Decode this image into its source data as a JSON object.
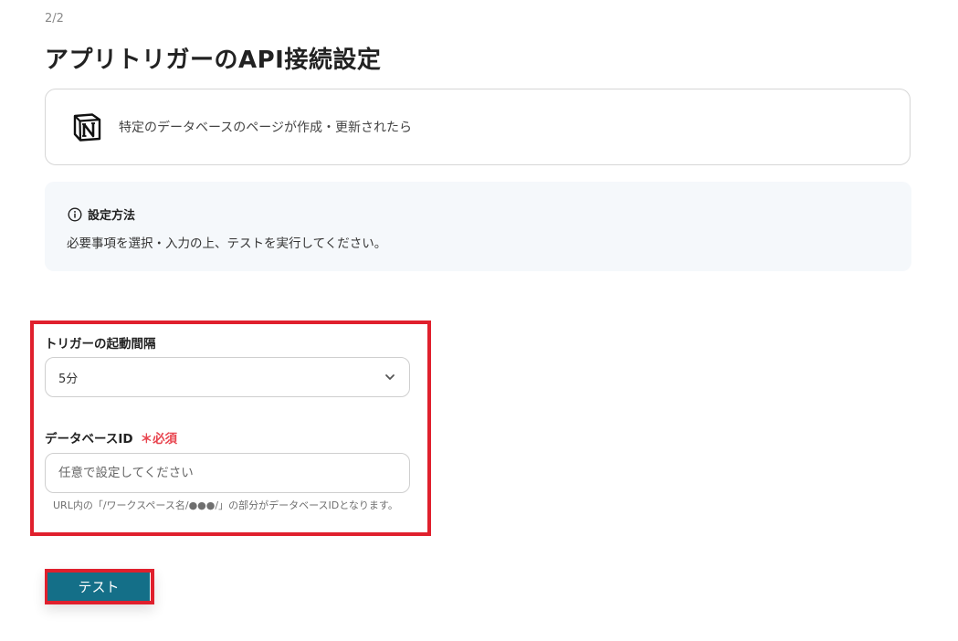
{
  "header": {
    "step": "2/2",
    "title": "アプリトリガーのAPI接続設定"
  },
  "trigger_card": {
    "icon": "notion-logo-icon",
    "description": "特定のデータベースのページが作成・更新されたら"
  },
  "help": {
    "icon": "info-icon",
    "heading": "設定方法",
    "text": "必要事項を選択・入力の上、テストを実行してください。"
  },
  "form": {
    "interval": {
      "label": "トリガーの起動間隔",
      "value": "5分",
      "icon": "chevron-down-icon"
    },
    "database_id": {
      "label": "データベースID",
      "required_mark": "＊",
      "required_label": "必須",
      "placeholder": "任意で設定してください",
      "value": "",
      "hint": "URL内の「/ワークスペース名/●●●/」の部分がデータベースIDとなります。"
    }
  },
  "actions": {
    "test_label": "テスト"
  },
  "colors": {
    "highlight": "#e0202d",
    "primary": "#146f88",
    "required": "#e8454f",
    "help_bg": "#f5f8fb"
  }
}
